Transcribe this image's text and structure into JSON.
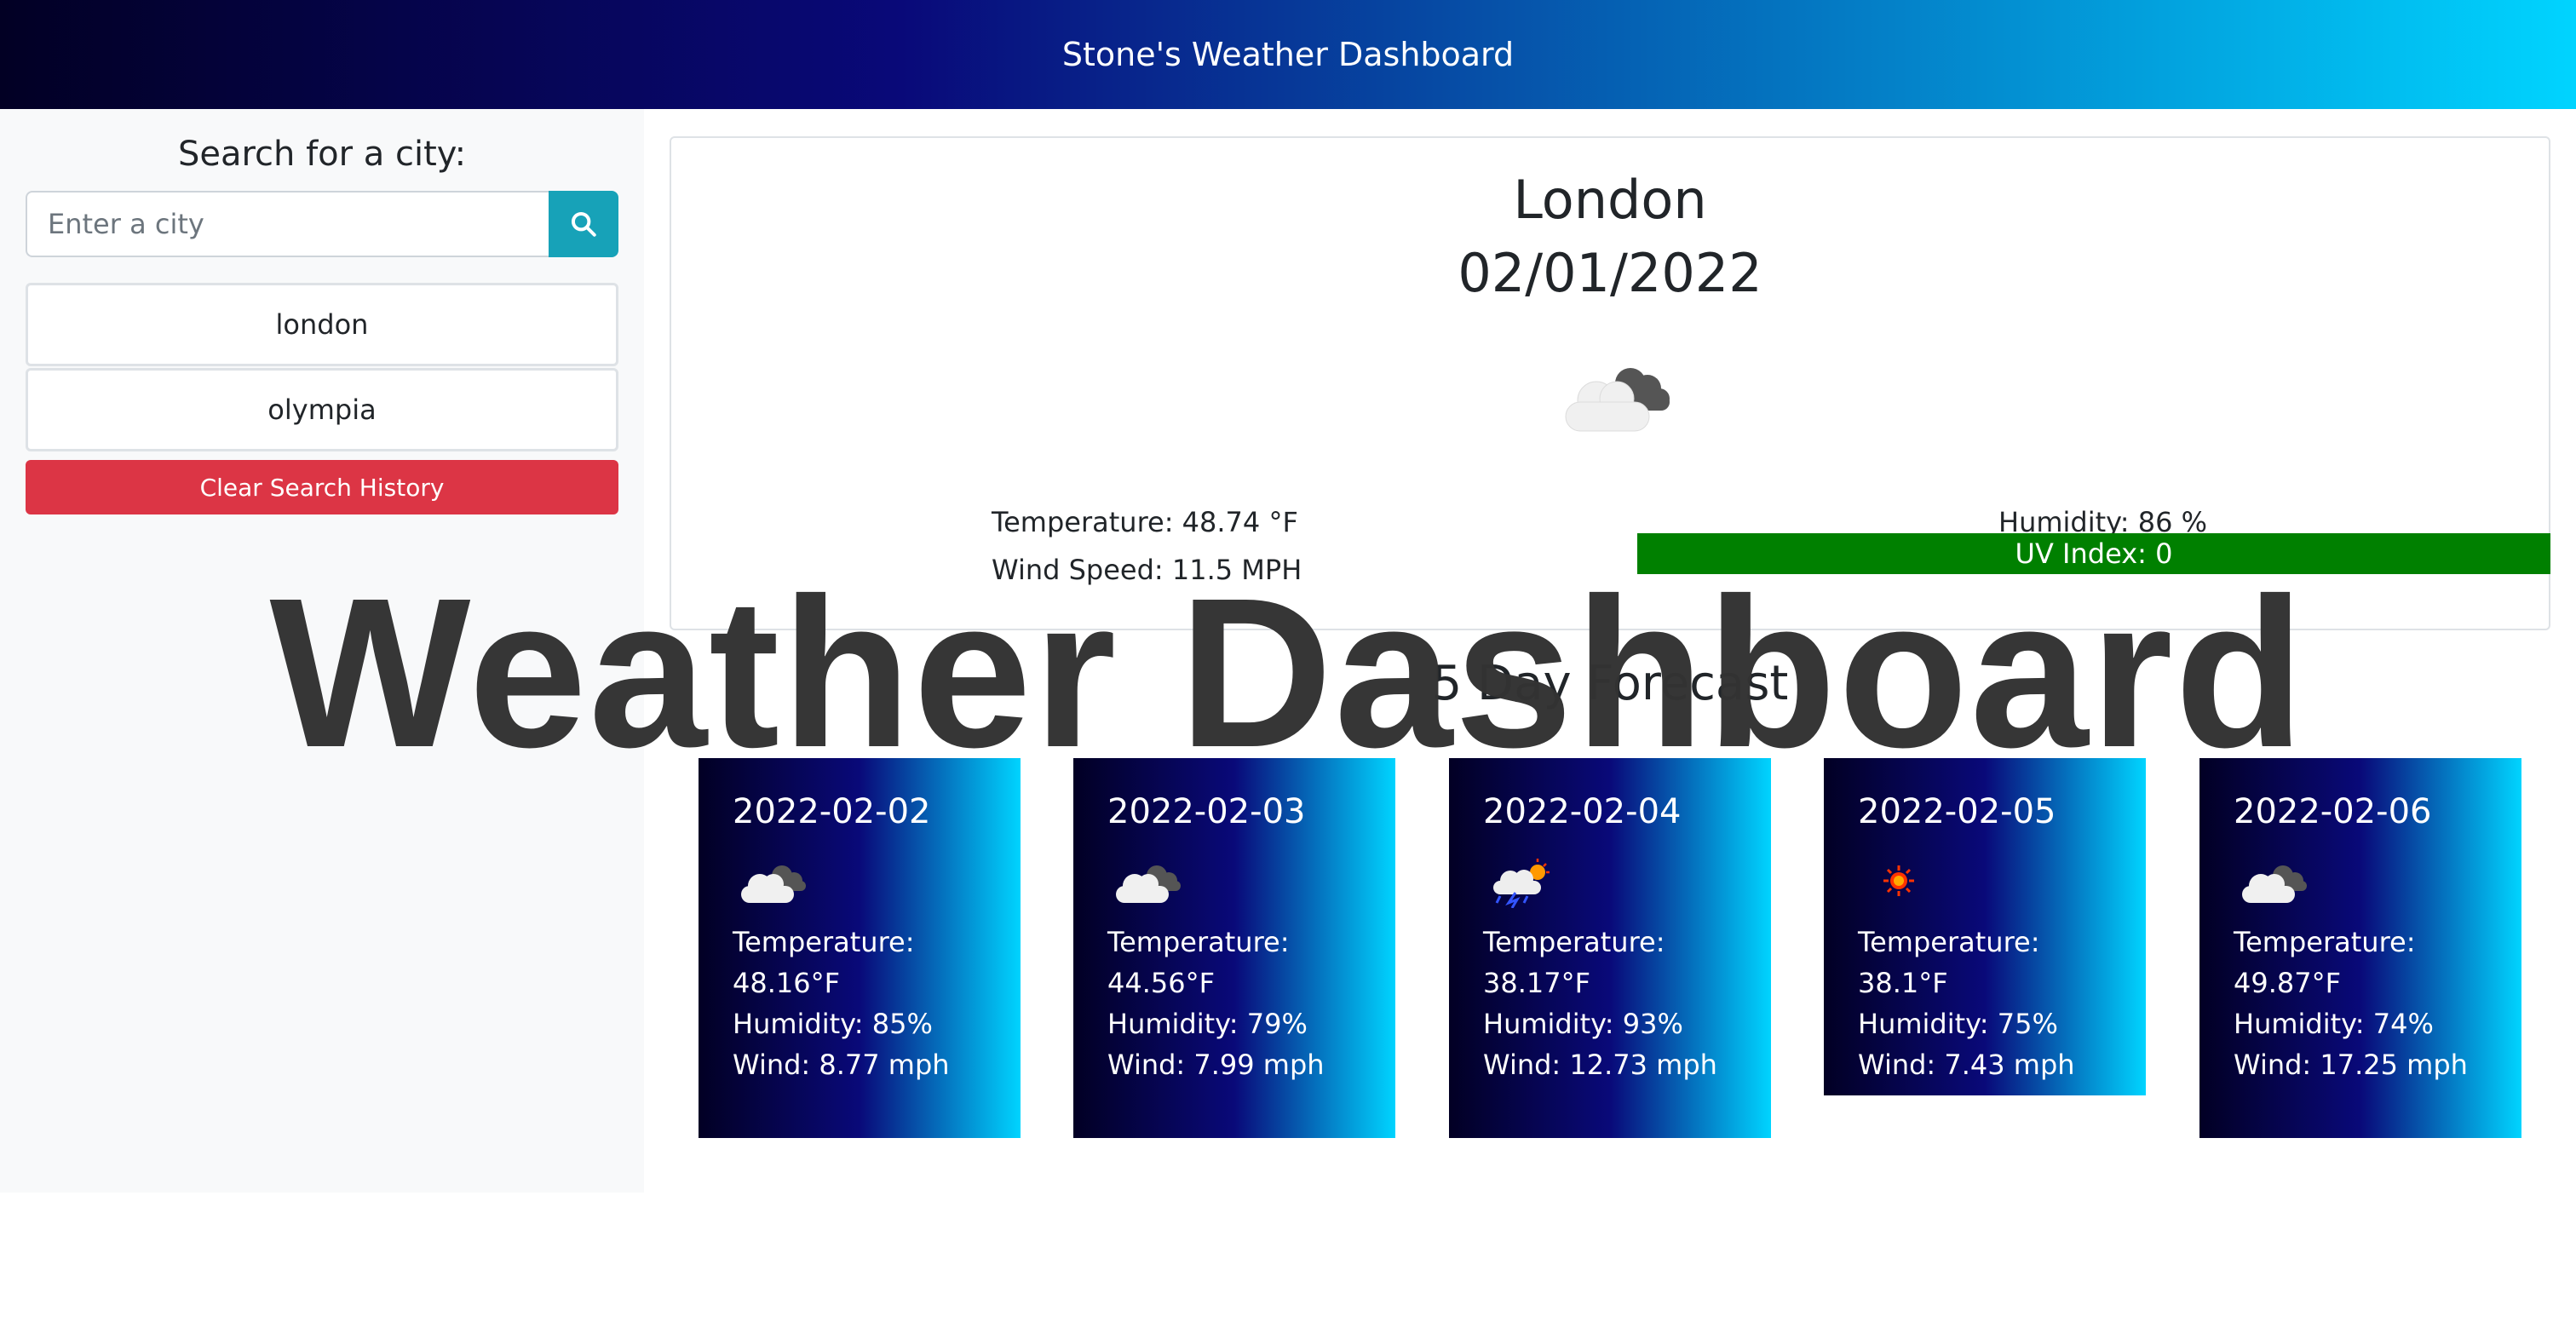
{
  "header": {
    "title": "Stone's Weather Dashboard"
  },
  "sidebar": {
    "search_title": "Search for a city:",
    "search_placeholder": "Enter a city",
    "search_icon": "search-icon",
    "history": [
      "london",
      "olympia"
    ],
    "clear_label": "Clear Search History"
  },
  "current": {
    "city": "London",
    "date": "02/01/2022",
    "icon": "cloudy-icon",
    "temperature": "Temperature: 48.74 °F",
    "wind": "Wind Speed: 11.5 MPH",
    "humidity": "Humidity: 86 %",
    "uv": "UV Index: 0",
    "uv_color": "#008000"
  },
  "forecast": {
    "title": "5 Day Forecast",
    "days": [
      {
        "date": "2022-02-02",
        "icon": "cloudy-icon",
        "temp_label": "Temperature:",
        "temp": "48.16°F",
        "humidity": "Humidity: 85%",
        "wind": "Wind: 8.77 mph"
      },
      {
        "date": "2022-02-03",
        "icon": "cloudy-icon",
        "temp_label": "Temperature:",
        "temp": "44.56°F",
        "humidity": "Humidity: 79%",
        "wind": "Wind: 7.99 mph"
      },
      {
        "date": "2022-02-04",
        "icon": "thunder-rain-icon",
        "temp_label": "Temperature:",
        "temp": "38.17°F",
        "humidity": "Humidity: 93%",
        "wind": "Wind: 12.73 mph"
      },
      {
        "date": "2022-02-05",
        "icon": "sun-icon",
        "temp_label": "Temperature: 38.1°F",
        "temp": "",
        "humidity": "Humidity: 75%",
        "wind": "Wind: 7.43 mph"
      },
      {
        "date": "2022-02-06",
        "icon": "cloudy-icon",
        "temp_label": "Temperature:",
        "temp": "49.87°F",
        "humidity": "Humidity: 74%",
        "wind": "Wind: 17.25 mph"
      }
    ]
  },
  "overlay": {
    "title": "Weather Dashboard"
  }
}
